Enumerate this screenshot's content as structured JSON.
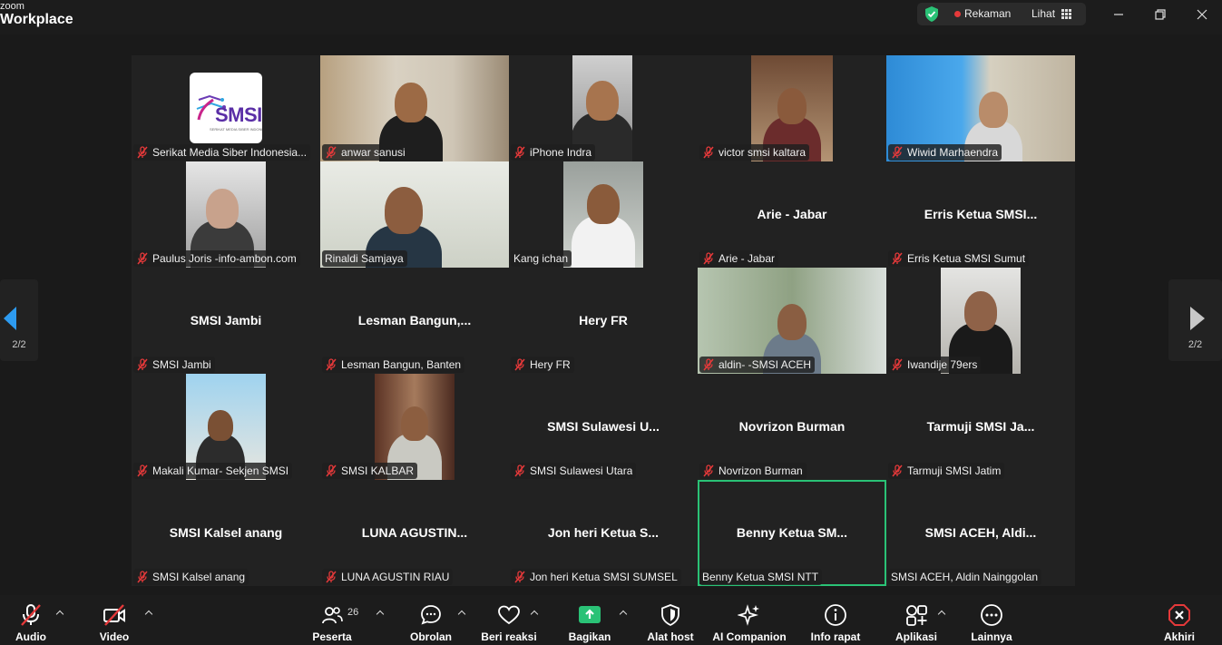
{
  "app": {
    "brand_small": "zoom",
    "brand_large": "Workplace"
  },
  "status": {
    "record_label": "Rekaman",
    "view_label": "Lihat"
  },
  "colors": {
    "active_speaker": "#2ac276",
    "recording": "#e5393a",
    "share_green": "#2ac276",
    "leave_red": "#e5393a",
    "muted_mic": "#e5393a"
  },
  "pagination": {
    "left": "2/2",
    "right": "2/2"
  },
  "tiles": [
    {
      "name": "Serikat Media Siber Indonesia...",
      "center": "",
      "type": "logo"
    },
    {
      "name": "anwar sanusi",
      "center": "",
      "type": "video"
    },
    {
      "name": "iPhone Indra",
      "center": "",
      "type": "video"
    },
    {
      "name": "victor smsi kaltara",
      "center": "",
      "type": "video"
    },
    {
      "name": "Wiwid Marhaendra",
      "center": "",
      "type": "video"
    },
    {
      "name": "Paulus  Joris -info-ambon.com",
      "center": "",
      "type": "video"
    },
    {
      "name": "Rinaldi Samjaya",
      "center": "",
      "type": "video"
    },
    {
      "name": "Kang ichan",
      "center": "",
      "type": "video"
    },
    {
      "name": "Arie - Jabar",
      "center": "Arie - Jabar",
      "type": "name"
    },
    {
      "name": "Erris Ketua SMSI Sumut",
      "center": "Erris  Ketua  SMSI...",
      "type": "name"
    },
    {
      "name": "SMSI Jambi",
      "center": "SMSI Jambi",
      "type": "name"
    },
    {
      "name": "Lesman Bangun, Banten",
      "center": "Lesman  Bangun,...",
      "type": "name"
    },
    {
      "name": "Hery FR",
      "center": "Hery FR",
      "type": "name"
    },
    {
      "name": "aldin- -SMSI ACEH",
      "center": "",
      "type": "video"
    },
    {
      "name": "Iwandije 79ers",
      "center": "",
      "type": "video"
    },
    {
      "name": "Makali Kumar- Sekjen SMSI",
      "center": "",
      "type": "video"
    },
    {
      "name": "SMSI KALBAR",
      "center": "",
      "type": "video"
    },
    {
      "name": "SMSI Sulawesi Utara",
      "center": "SMSI  Sulawesi  U...",
      "type": "name"
    },
    {
      "name": "Novrizon Burman",
      "center": "Novrizon Burman",
      "type": "name"
    },
    {
      "name": "Tarmuji SMSI Jatim",
      "center": "Tarmuji  SMSI  Ja...",
      "type": "name"
    },
    {
      "name": "SMSI Kalsel anang",
      "center": "SMSI Kalsel anang",
      "type": "name"
    },
    {
      "name": "LUNA AGUSTIN RIAU",
      "center": "LUNA  AGUSTIN...",
      "type": "name"
    },
    {
      "name": "Jon heri Ketua SMSI SUMSEL",
      "center": "Jon  heri  Ketua  S...",
      "type": "name"
    },
    {
      "name": "Benny Ketua SMSI NTT",
      "center": "Benny  Ketua  SM...",
      "type": "name",
      "active": true
    },
    {
      "name": "SMSI ACEH, Aldin Nainggolan",
      "center": "SMSI  ACEH,  Aldi...",
      "type": "name"
    }
  ],
  "logo_text": {
    "main": "SMSI",
    "sub": "SERIKAT MEDIA SIBER INDONESIA"
  },
  "toolbar": {
    "audio": "Audio",
    "video": "Video",
    "participants": "Peserta",
    "participants_count": "26",
    "chat": "Obrolan",
    "react": "Beri reaksi",
    "share": "Bagikan",
    "host_tools": "Alat host",
    "ai": "AI Companion",
    "info": "Info rapat",
    "apps": "Aplikasi",
    "more": "Lainnya",
    "end": "Akhiri"
  }
}
